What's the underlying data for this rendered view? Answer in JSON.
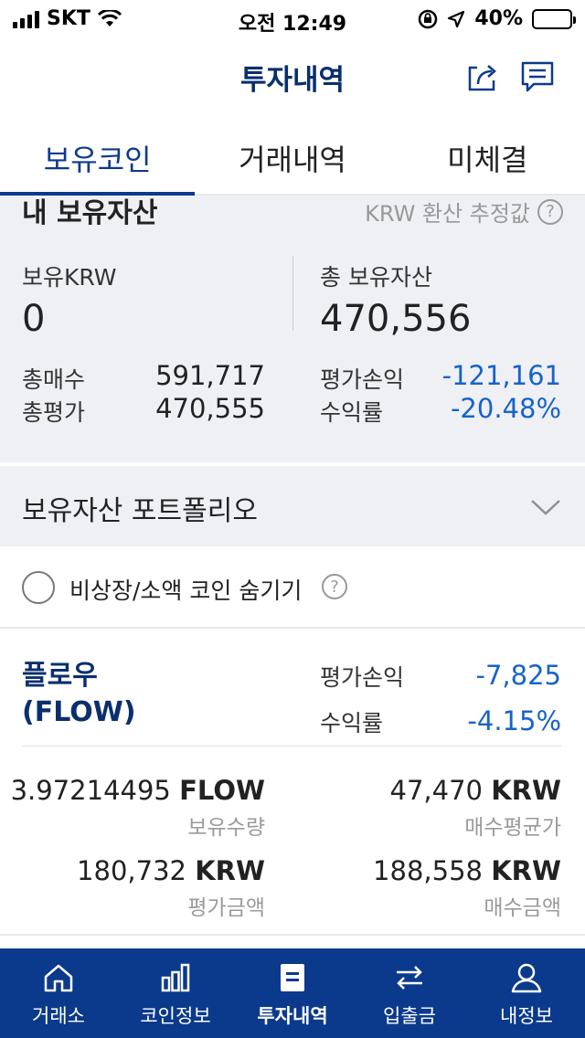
{
  "status_bar": {
    "carrier": "SKT",
    "time": "오전 12:49",
    "battery": "40%"
  },
  "header": {
    "title": "투자내역"
  },
  "tabs": [
    {
      "label": "보유코인",
      "active": true
    },
    {
      "label": "거래내역",
      "active": false
    },
    {
      "label": "미체결",
      "active": false
    }
  ],
  "summary": {
    "heading": "내 보유자산",
    "note": "KRW 환산 추정값",
    "krw_label": "보유KRW",
    "krw_value": "0",
    "total_label": "총 보유자산",
    "total_value": "470,556",
    "buy_total_label": "총매수",
    "buy_total_value": "591,717",
    "eval_total_label": "총평가",
    "eval_total_value": "470,555",
    "pnl_label": "평가손익",
    "pnl_value": "-121,161",
    "return_label": "수익률",
    "return_value": "-20.48%"
  },
  "portfolio": {
    "title": "보유자산 포트폴리오"
  },
  "hide_option": {
    "label": "비상장/소액 코인 숨기기"
  },
  "coin": {
    "name_kr": "플로우",
    "symbol": "(FLOW)",
    "pnl_label": "평가손익",
    "pnl_value": "-7,825",
    "return_label": "수익률",
    "return_value": "-4.15%",
    "qty_value": "3.97214495",
    "qty_unit": "FLOW",
    "qty_label": "보유수량",
    "avg_value": "47,470",
    "avg_unit": "KRW",
    "avg_label": "매수평균가",
    "eval_value": "180,732",
    "eval_unit": "KRW",
    "eval_label": "평가금액",
    "buy_value": "188,558",
    "buy_unit": "KRW",
    "buy_label": "매수금액"
  },
  "bottom_nav": [
    {
      "label": "거래소",
      "icon": "home-icon",
      "active": false
    },
    {
      "label": "코인정보",
      "icon": "bar-chart-icon",
      "active": false
    },
    {
      "label": "투자내역",
      "icon": "document-icon",
      "active": true
    },
    {
      "label": "입출금",
      "icon": "transfer-icon",
      "active": false
    },
    {
      "label": "내정보",
      "icon": "user-icon",
      "active": false
    }
  ],
  "colors": {
    "primary": "#0b3a8c",
    "negative": "#1763c9",
    "panel": "#eef0f4"
  }
}
